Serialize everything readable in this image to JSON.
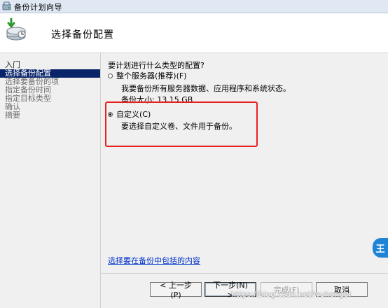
{
  "window": {
    "title": "备份计划向导",
    "page_title": "选择备份配置"
  },
  "sidebar": {
    "items": [
      {
        "label": "入门",
        "state": "done"
      },
      {
        "label": "选择备份配置",
        "state": "active"
      },
      {
        "label": "选择要备份的项",
        "state": "pending"
      },
      {
        "label": "指定备份时间",
        "state": "pending"
      },
      {
        "label": "指定目标类型",
        "state": "pending"
      },
      {
        "label": "确认",
        "state": "pending"
      },
      {
        "label": "摘要",
        "state": "pending"
      }
    ]
  },
  "content": {
    "question": "要计划进行什么类型的配置?",
    "option_full": {
      "label": "整个服务器(推荐)(F)",
      "description": "我要备份所有服务器数据、应用程序和系统状态。",
      "size": "备份大小: 13.15 GB",
      "checked": false
    },
    "option_custom": {
      "label": "自定义(C)",
      "description": "要选择自定义卷、文件用于备份。",
      "checked": true
    },
    "info_link": "选择要在备份中包括的内容"
  },
  "buttons": {
    "back": "< 上一步(P)",
    "next": "下一步(N) >",
    "finish": "完成(F)",
    "cancel": "取消"
  },
  "badge": {
    "label": "王"
  },
  "watermark": "https://blog.csdn.net/wuhongbi",
  "colors": {
    "active_item": "#0a246a",
    "highlight": "#e8211d",
    "link": "#0033cc",
    "badge": "#1f84d6"
  }
}
